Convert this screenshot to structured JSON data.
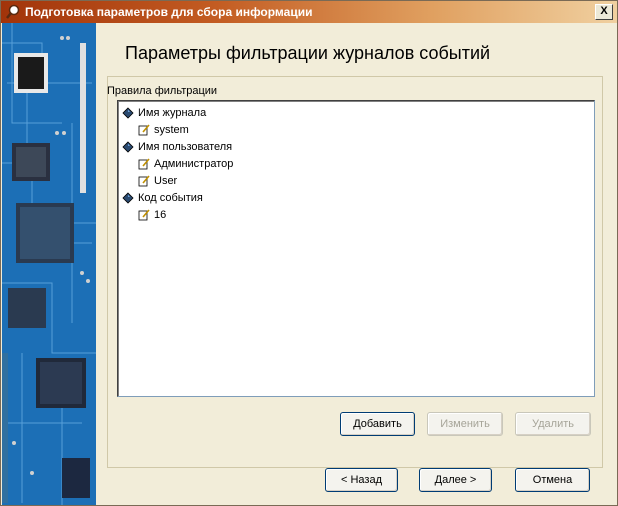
{
  "window": {
    "title": "Подготовка параметров для сбора информации",
    "close_label": "X"
  },
  "page": {
    "heading": "Параметры фильтрации журналов событий"
  },
  "filter_group": {
    "label": "Правила фильтрации",
    "tree": [
      {
        "label": "Имя журнала",
        "icon": "diamond-icon",
        "children": [
          "system"
        ]
      },
      {
        "label": "Имя пользователя",
        "icon": "diamond-icon",
        "children": [
          "Администратор",
          "User"
        ]
      },
      {
        "label": "Код события",
        "icon": "diamond-icon",
        "children": [
          "16"
        ]
      }
    ],
    "buttons": {
      "add": "Добавить",
      "edit": "Изменить",
      "delete": "Удалить"
    }
  },
  "footer": {
    "back": "< Назад",
    "next": "Далее >",
    "cancel": "Отмена"
  },
  "colors": {
    "title_start": "#a2340a",
    "side_panel": "#1c70b8",
    "window_bg": "#f2edd9"
  }
}
